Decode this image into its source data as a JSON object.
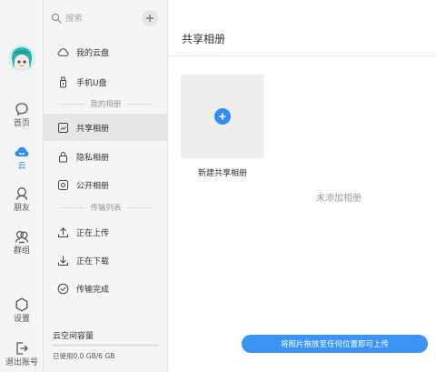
{
  "rail": {
    "items": [
      {
        "label": "首页",
        "icon": "chat-bubble-icon"
      },
      {
        "label": "云",
        "icon": "cloud-icon",
        "active": true
      },
      {
        "label": "朋友",
        "icon": "friends-icon"
      },
      {
        "label": "群组",
        "icon": "group-icon"
      },
      {
        "label": "设置",
        "icon": "settings-icon"
      },
      {
        "label": "退出账号",
        "icon": "logout-icon"
      }
    ]
  },
  "nav": {
    "search_placeholder": "搜索",
    "items": [
      {
        "label": "我的云盘",
        "icon": "cloud-outline-icon"
      },
      {
        "label": "手机U盘",
        "icon": "usb-drive-icon"
      },
      {
        "label": "共享相册",
        "icon": "shared-album-icon",
        "active": true
      },
      {
        "label": "隐私相册",
        "icon": "lock-icon"
      },
      {
        "label": "公开相册",
        "icon": "public-album-icon"
      },
      {
        "label": "正在上传",
        "icon": "upload-icon"
      },
      {
        "label": "正在下载",
        "icon": "download-icon"
      },
      {
        "label": "传输完成",
        "icon": "check-circle-icon"
      }
    ],
    "sections": {
      "albums": "我的相册",
      "transfers": "传输列表"
    },
    "storage": {
      "title": "云空间容量",
      "used_text": "已使用0.0 GB/6 GB",
      "used_fraction": 0
    }
  },
  "main": {
    "title": "共享相册",
    "new_album_label": "新建共享相册",
    "empty_text": "未添加相册",
    "upload_hint": "将照片拖放至任何位置即可上传"
  },
  "colors": {
    "accent": "#2e8ff0",
    "sidebar_bg": "#f5f5f5",
    "active_bg": "#e6e6e6",
    "upload_button": "#3a94f3"
  }
}
